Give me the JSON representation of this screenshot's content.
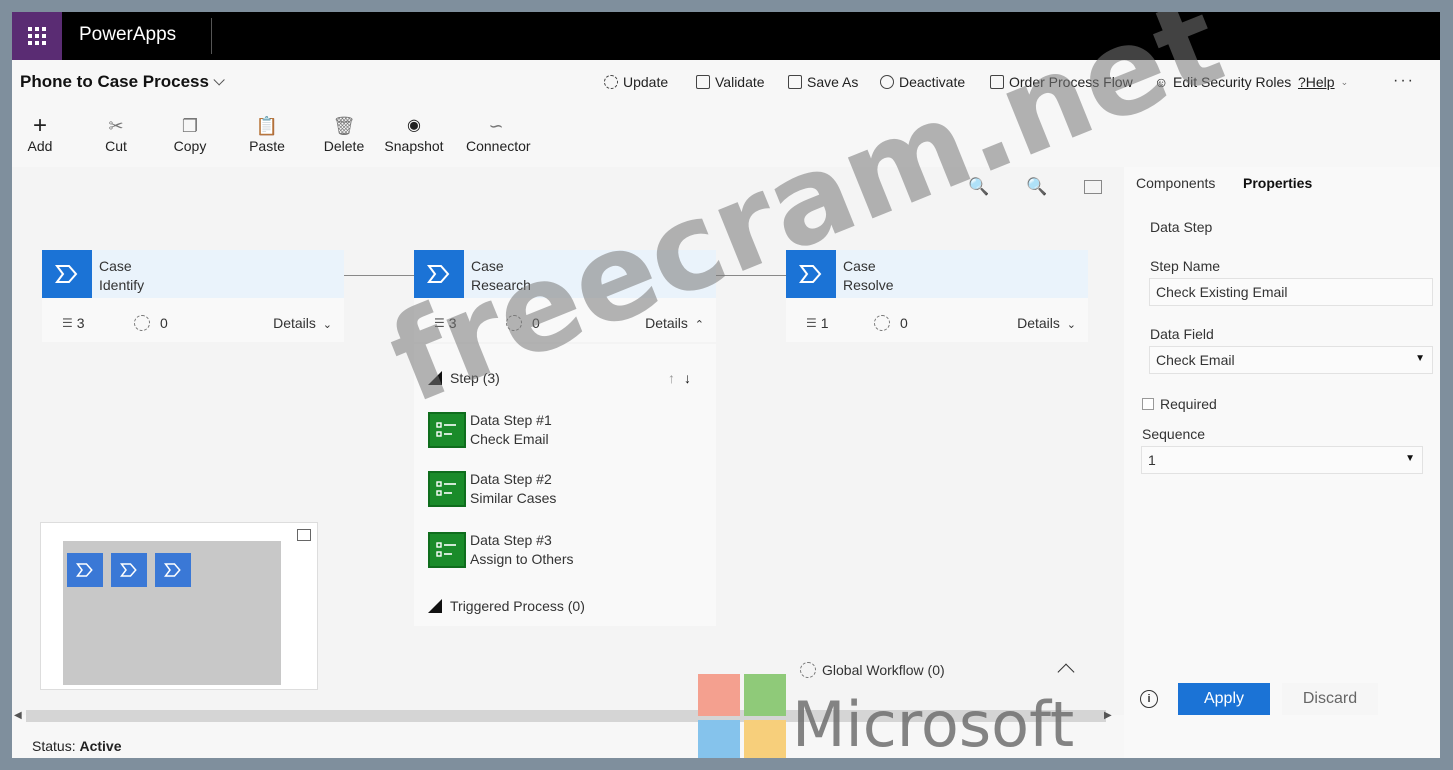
{
  "app": {
    "name": "PowerApps"
  },
  "header": {
    "title": "Phone to Case Process",
    "commands": [
      {
        "label": "Update",
        "icon": "refresh-icon"
      },
      {
        "label": "Validate",
        "icon": "clipboard-icon"
      },
      {
        "label": "Save As",
        "icon": "save-icon"
      },
      {
        "label": "Deactivate",
        "icon": "deactivate-icon"
      },
      {
        "label": "Order Process Flow",
        "icon": "document-icon"
      },
      {
        "label": "Edit Security Roles",
        "icon": "people-icon"
      },
      {
        "label": "?Help",
        "icon": "help-icon"
      }
    ],
    "more": "···"
  },
  "toolbar": {
    "add": "Add",
    "cut": "Cut",
    "copy": "Copy",
    "paste": "Paste",
    "delete": "Delete",
    "snapshot": "Snapshot",
    "connector": "Connector"
  },
  "stages": [
    {
      "line1": "Case",
      "line2": "Identify",
      "steps": "3",
      "conditions": "0",
      "details": "Details"
    },
    {
      "line1": "Case",
      "line2": "Research",
      "steps": "3",
      "conditions": "0",
      "details": "Details"
    },
    {
      "line1": "Case",
      "line2": "Resolve",
      "steps": "1",
      "conditions": "0",
      "details": "Details"
    }
  ],
  "expanded": {
    "steps_header": "Step (3)",
    "data_steps": [
      {
        "title": "Data Step #1",
        "name": "Check Email"
      },
      {
        "title": "Data Step #2",
        "name": "Similar Cases"
      },
      {
        "title": "Data Step #3",
        "name": "Assign to Others"
      }
    ],
    "triggered": "Triggered Process (0)"
  },
  "global_workflow": "Global Workflow (0)",
  "status": {
    "label": "Status:",
    "value": "Active"
  },
  "panel": {
    "tabs": {
      "components": "Components",
      "properties": "Properties"
    },
    "section": "Data Step",
    "step_name_label": "Step Name",
    "step_name_value": "Check Existing Email",
    "data_field_label": "Data Field",
    "data_field_value": "Check Email",
    "required_label": "Required",
    "sequence_label": "Sequence",
    "sequence_value": "1",
    "apply": "Apply",
    "discard": "Discard",
    "info": "i"
  },
  "watermark": {
    "text": "freecram.net",
    "brand": "Microsoft"
  },
  "colors": {
    "accent": "#1b73d6",
    "step_green": "#1a8b2a",
    "waffle": "#5a2c73"
  }
}
